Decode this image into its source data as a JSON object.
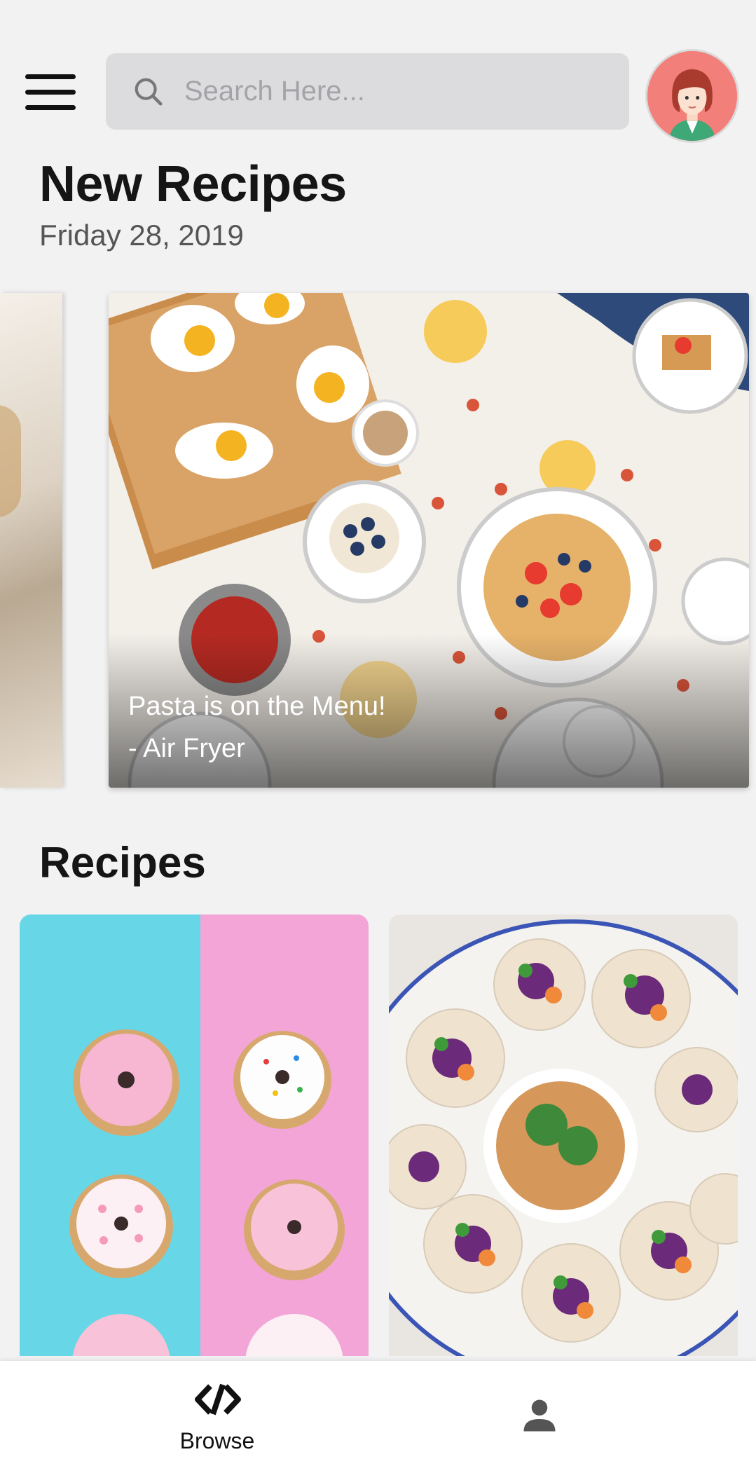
{
  "header": {
    "menu_icon": "hamburger-menu-icon",
    "search": {
      "placeholder": "Search Here...",
      "icon": "search-icon"
    },
    "avatar_icon": "user-avatar-icon"
  },
  "new_recipes": {
    "title": "New Recipes",
    "date": "Friday 28, 2019",
    "featured": {
      "caption_line1": "Pasta is on the Menu!",
      "caption_line2": "- Air Fryer"
    }
  },
  "recipes": {
    "title": "Recipes",
    "tiles": [
      "donuts-image",
      "spring-rolls-image"
    ]
  },
  "bottom_nav": {
    "browse_label": "Browse",
    "browse_icon": "browse-logo-icon",
    "profile_icon": "person-icon"
  },
  "colors": {
    "background": "#f2f2f2",
    "search_bg": "#dcdcde",
    "avatar_bg": "#f27f7a",
    "text": "#151515"
  }
}
